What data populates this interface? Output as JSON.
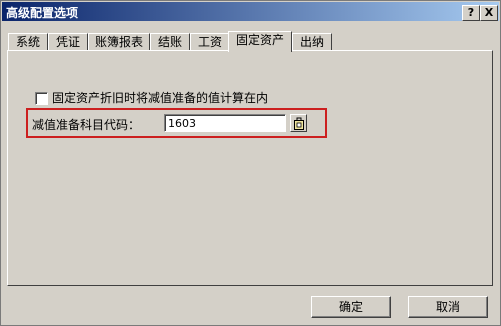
{
  "window": {
    "title": "高级配置选项",
    "help_label": "?",
    "close_label": "X"
  },
  "tabs": [
    {
      "label": "系统",
      "active": false
    },
    {
      "label": "凭证",
      "active": false
    },
    {
      "label": "账簿报表",
      "active": false
    },
    {
      "label": "结账",
      "active": false
    },
    {
      "label": "工资",
      "active": false
    },
    {
      "label": "固定资产",
      "active": true
    },
    {
      "label": "出纳",
      "active": false
    }
  ],
  "fixed_assets": {
    "checkbox_label": "固定资产折旧时将减值准备的值计算在内",
    "checkbox_checked": false,
    "field_label": "减值准备科目代码：",
    "field_value": "1603",
    "highlight_color": "#cc1f1f"
  },
  "footer": {
    "ok_label": "确定",
    "cancel_label": "取消"
  }
}
